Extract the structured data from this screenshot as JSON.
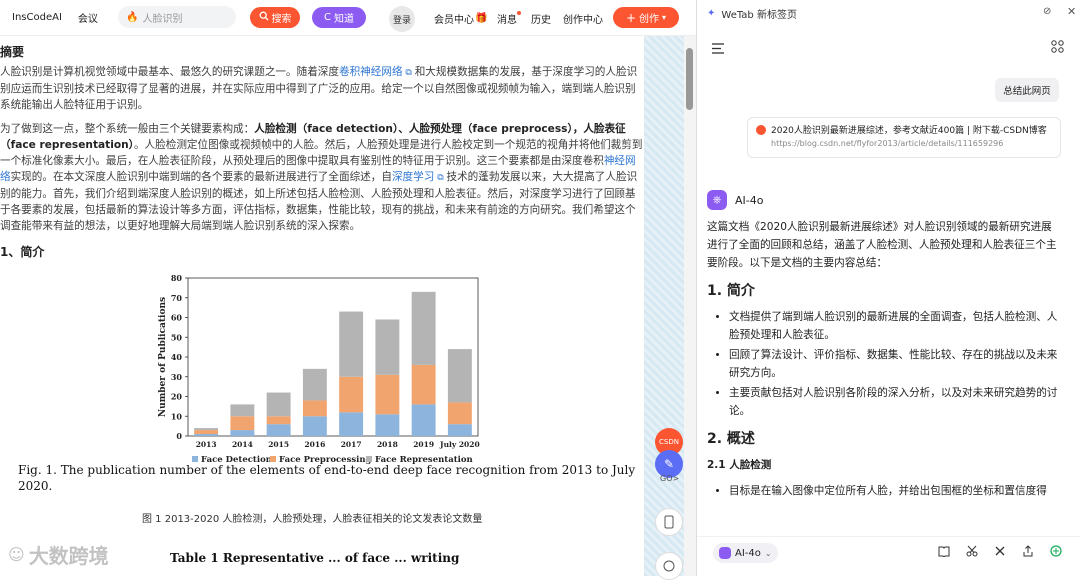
{
  "topnav": {
    "brand": "InsCodeAI",
    "meeting": "会议",
    "search_placeholder": "人脸识别",
    "search_btn": "搜索",
    "zhidao_btn": "知道",
    "login": "登录",
    "member": "会员中心",
    "messages": "消息",
    "history": "历史",
    "creator": "创作中心",
    "create": "创作"
  },
  "article": {
    "abstract_title": "摘要",
    "p1_a": "人脸识别是计算机视觉领域中最基本、最悠久的研究课题之一。随着深度",
    "p1_link": "卷积神经网络",
    "p1_b": "和大规模数据集的发展，基于深度学习的人脸识别应运而生识别技术已经取得了显著的进展，并在实际应用中得到了广泛的应用。给定一个以自然图像或视频帧为输入，端到端人脸识别系统能输出人脸特征用于识别。",
    "p2_a": "为了做到这一点，整个系统一般由三个关键要素构成：",
    "p2_b1": "人脸检测（face detection）、人脸预处理（face preprocess），人脸表征（face representation）",
    "p2_c": "。人脸检测定位图像或视频帧中的人脸。然后，人脸预处理是进行人脸校定到一个规范的视角并将他们裁剪到一个标准化像素大小。最后，在人脸表征阶段，从预处理后的图像中提取具有鉴别性的特征用于识别。这三个要素都是由深度卷积",
    "p2_link1": "神经网络",
    "p2_d": "实现的。在本文深度人脸识别中端到端的各个要素的最新进展进行了全面综述，自",
    "p2_link2": "深度学习",
    "p2_e": "技术的蓬勃发展以来，大大提高了人脸识别的能力。首先，我们介绍到端深度人脸识别的概述，如上所述包括人脸检测、人脸预处理和人脸表征。然后，对深度学习进行了回顾基于各要素的发展，包括最新的算法设计等多方面，评估指标，数据集，性能比较，现有的挑战，和未来有前途的方向研究。我们希望这个调查能带来有益的想法，以更好地理解大局端到端人脸识别系统的深入探索。",
    "section1": "1、简介",
    "fig_caption": "Fig. 1.  The publication number of the elements of end-to-end deep face recognition from 2013 to July 2020.",
    "fig_caption_cn": "图 1 2013-2020 人脸检测，人脸预处理，人脸表征相关的论文发表论文数量",
    "table_caption_partial": "Table 1  Representative ... of face ... writing",
    "watermark": "大数跨境"
  },
  "chart_data": {
    "type": "bar",
    "stacked": true,
    "categories": [
      "2013",
      "2014",
      "2015",
      "2016",
      "2017",
      "2018",
      "2019",
      "July 2020"
    ],
    "series": [
      {
        "name": "Face Detection",
        "color": "#8db4dc",
        "values": [
          1,
          3,
          6,
          10,
          12,
          11,
          16,
          6
        ]
      },
      {
        "name": "Face Preprocessing",
        "color": "#f2a46f",
        "values": [
          2,
          7,
          4,
          8,
          18,
          20,
          20,
          11
        ]
      },
      {
        "name": "Face Representation",
        "color": "#b4b4b4",
        "values": [
          1,
          6,
          12,
          16,
          33,
          28,
          37,
          27
        ]
      }
    ],
    "ylabel": "Number of Publications",
    "xlabel": "",
    "ylim": [
      0,
      80
    ],
    "yticks": [
      0,
      10,
      20,
      30,
      40,
      50,
      60,
      70,
      80
    ],
    "grid": false,
    "legend_position": "bottom"
  },
  "panel": {
    "title": "WeTab 新标签页",
    "summarize_btn": "总结此网页",
    "source_title": "2020人脸识别最新进展综述，参考文献近400篇 | 附下载-CSDN博客",
    "source_url": "https://blog.csdn.net/flyfor2013/article/details/111659296",
    "ai_name": "AI-4o",
    "intro": "这篇文档《2020人脸识别最新进展综述》对人脸识别领域的最新研究进展进行了全面的回顾和总结，涵盖了人脸检测、人脸预处理和人脸表征三个主要阶段。以下是文档的主要内容总结：",
    "h1": "1. 简介",
    "b1": "文档提供了端到端人脸识别的最新进展的全面调查，包括人脸检测、人脸预处理和人脸表征。",
    "b2": "回顾了算法设计、评价指标、数据集、性能比较、存在的挑战以及未来研究方向。",
    "b3": "主要贡献包括对人脸识别各阶段的深入分析，以及对未来研究趋势的讨论。",
    "h2": "2. 概述",
    "h3": "2.1 人脸检测",
    "b4": "目标是在输入图像中定位所有人脸，并给出包围框的坐标和置信度得",
    "model_label": "AI-4o",
    "csdn_badge": "CSDN",
    "go_label": "GO>"
  }
}
